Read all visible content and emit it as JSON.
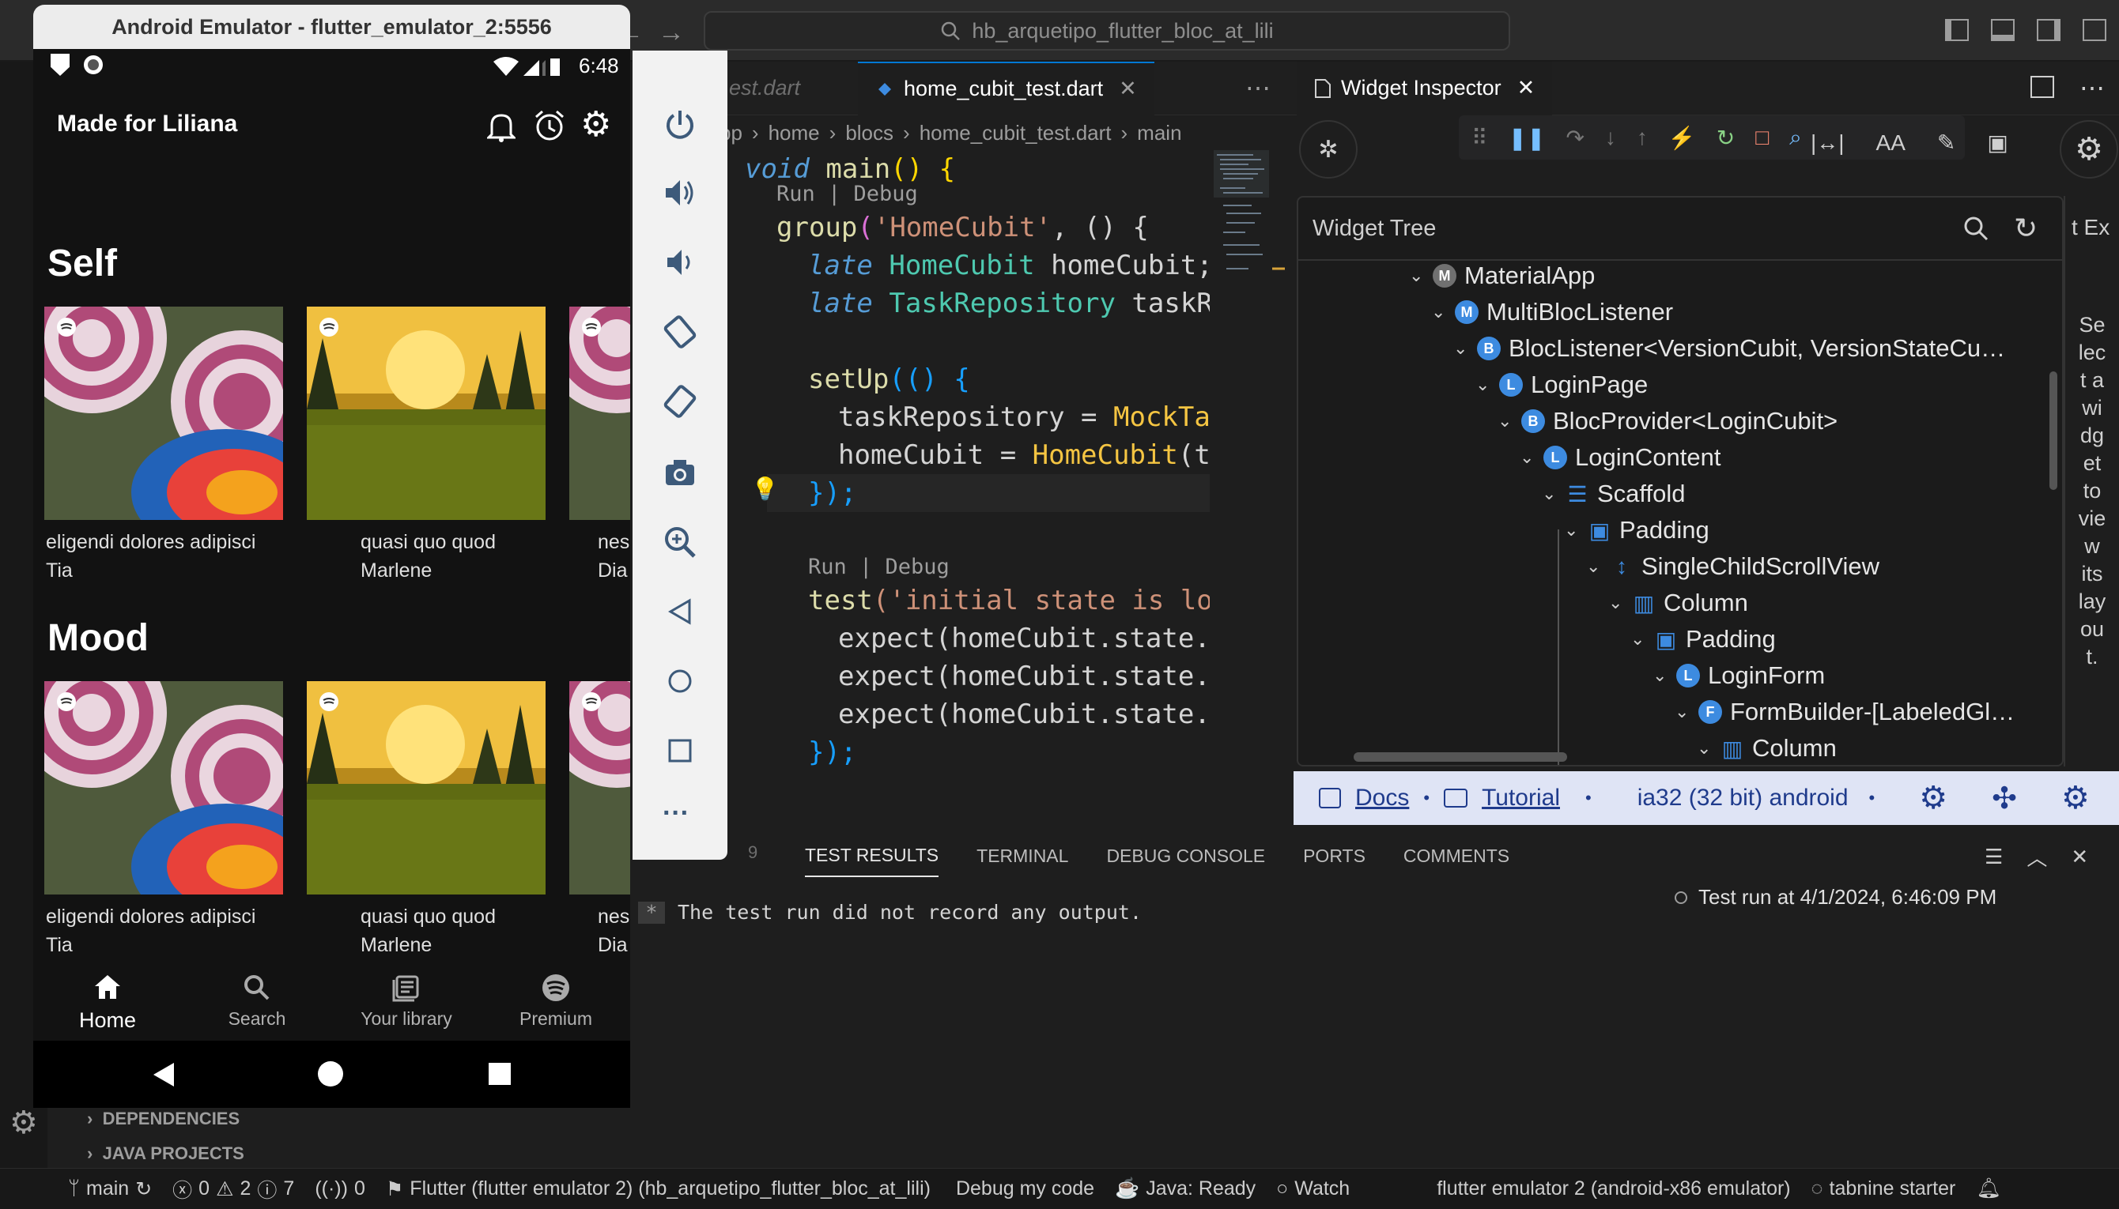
{
  "vscode": {
    "search_text": "hb_arquetipo_flutter_bloc_at_lili",
    "editor_tabs": [
      "est.dart",
      "home_cubit_test.dart"
    ],
    "breadcrumb": [
      "pp",
      "home",
      "blocs",
      "home_cubit_test.dart",
      "main"
    ],
    "code": {
      "codelens_1": "Run | Debug",
      "codelens_2": "Run | Debug",
      "l1_kw": "void",
      "l1_fn": "main",
      "l1_rest": "() {",
      "l2_fn": "group",
      "l2_str": "'HomeCubit'",
      "l2_rest": ", () {",
      "l3_kw": "late",
      "l3_ty": "HomeCubit",
      "l3_rest": " homeCubit;",
      "l4_kw": "late",
      "l4_ty": "TaskRepository",
      "l4_rest": " taskRep",
      "l5_fn": "setUp",
      "l5_rest": "(() {",
      "l6_a": "taskRepository = ",
      "l6_cls": "MockTask",
      "l7_a": "homeCubit = ",
      "l7_cls": "HomeCubit",
      "l7_rest": "(tas",
      "l8": "});",
      "l9_fn": "test",
      "l9_str": "('initial state is load",
      "l10": "expect(homeCubit.state.lo",
      "l11": "expect(homeCubit.state.sc",
      "l12": "expect(homeCubit.state.er",
      "l13": "});"
    },
    "inspector": {
      "tab_label": "Widget Inspector",
      "tree_title": "Widget Tree",
      "side_text": [
        "Se",
        "lec",
        "t a",
        "wi",
        "dg",
        "et",
        "to",
        "vie",
        "w",
        "its",
        "lay",
        "ou",
        "t."
      ],
      "side_tab": "t Ex",
      "nodes": [
        {
          "label": "MaterialApp",
          "badge": "M",
          "kind": "gray"
        },
        {
          "label": "MultiBlocListener",
          "badge": "M",
          "kind": "blue"
        },
        {
          "label": "BlocListener<VersionCubit, VersionStateCu…",
          "badge": "B",
          "kind": "blue"
        },
        {
          "label": "LoginPage",
          "badge": "L",
          "kind": "blue"
        },
        {
          "label": "BlocProvider<LoginCubit>",
          "badge": "B",
          "kind": "blue"
        },
        {
          "label": "LoginContent",
          "badge": "L",
          "kind": "blue"
        },
        {
          "label": "Scaffold",
          "badge": "",
          "kind": "scaffold"
        },
        {
          "label": "Padding",
          "badge": "",
          "kind": "padding"
        },
        {
          "label": "SingleChildScrollView",
          "badge": "",
          "kind": "scroll"
        },
        {
          "label": "Column",
          "badge": "",
          "kind": "column"
        },
        {
          "label": "Padding",
          "badge": "",
          "kind": "padding"
        },
        {
          "label": "LoginForm",
          "badge": "L",
          "kind": "blue"
        },
        {
          "label": "FormBuilder-[LabeledGl…",
          "badge": "F",
          "kind": "blue"
        },
        {
          "label": "Column",
          "badge": "",
          "kind": "column"
        }
      ],
      "status": {
        "docs": "Docs",
        "tutorial": "Tutorial",
        "device": "ia32 (32 bit) android"
      }
    },
    "panel": {
      "line_number": "9",
      "tabs": [
        "TEST RESULTS",
        "TERMINAL",
        "DEBUG CONSOLE",
        "PORTS",
        "COMMENTS"
      ],
      "output": "The test run did not record any output.",
      "test_run": "Test run at 4/1/2024, 6:46:09 PM"
    },
    "explorer": {
      "dependencies": "DEPENDENCIES",
      "java_projects": "JAVA PROJECTS"
    },
    "statusbar": {
      "branch": "main",
      "errors": "0",
      "warnings": "2",
      "infos": "7",
      "ports": "0",
      "flutter": "Flutter (flutter emulator 2) (hb_arquetipo_flutter_bloc_at_lili)",
      "debug": "Debug my code",
      "java": "Java: Ready",
      "watch": "Watch",
      "device": "flutter emulator 2 (android-x86 emulator)",
      "tabnine": "tabnine starter"
    }
  },
  "emulator": {
    "title": "Android Emulator - flutter_emulator_2:5556",
    "time": "6:48",
    "app_title": "Made for Liliana",
    "sections": [
      {
        "heading": "Self",
        "cards": [
          {
            "title": "eligendi dolores adipisci",
            "subtitle": "Tia"
          },
          {
            "title": "quasi quo quod",
            "subtitle": "Marlene"
          },
          {
            "title": "nes",
            "subtitle": "Dia"
          }
        ]
      },
      {
        "heading": "Mood",
        "cards": [
          {
            "title": "eligendi dolores adipisci",
            "subtitle": "Tia"
          },
          {
            "title": "quasi quo quod",
            "subtitle": "Marlene"
          },
          {
            "title": "nes",
            "subtitle": "Dia"
          }
        ]
      }
    ],
    "nav": [
      {
        "label": "Home",
        "icon": "home-icon",
        "active": true
      },
      {
        "label": "Search",
        "icon": "search-icon",
        "active": false
      },
      {
        "label": "Your library",
        "icon": "library-icon",
        "active": false
      },
      {
        "label": "Premium",
        "icon": "spotify-icon",
        "active": false
      }
    ]
  },
  "colors": {
    "accent": "#0078d4",
    "inspector_status_bg": "#dfe4f5",
    "badge_blue": "#3d8be0"
  }
}
